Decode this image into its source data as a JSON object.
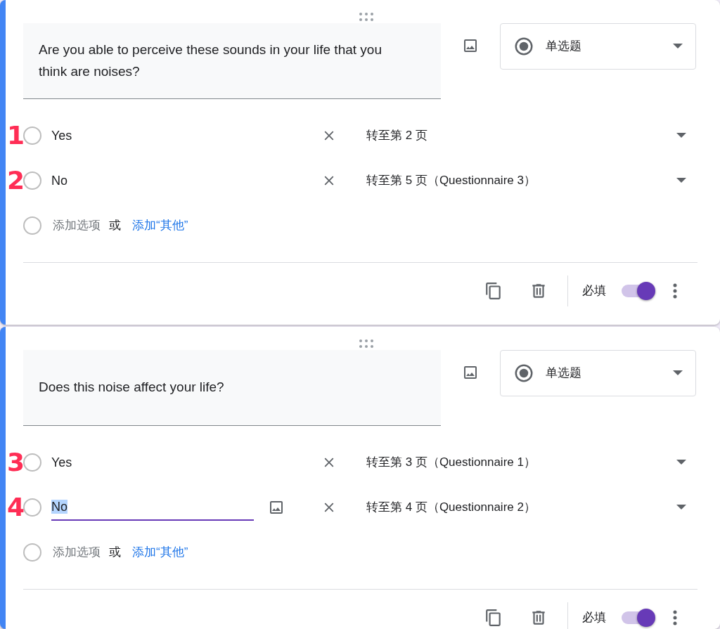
{
  "questions": [
    {
      "title": "Are you able to perceive these sounds in your life that you think are noises?",
      "type_label": "单选题",
      "options": [
        {
          "marker": "1",
          "label": "Yes",
          "checked": false,
          "editing": false,
          "goto": "转至第 2 页"
        },
        {
          "marker": "2",
          "label": "No",
          "checked": false,
          "editing": false,
          "goto": "转至第 5 页（Questionnaire 3）"
        }
      ],
      "add_option_checked": false,
      "add_option": "添加选项",
      "or": "或",
      "add_other": "添加“其他”",
      "required_label": "必填",
      "required": true
    },
    {
      "title": "Does this noise affect your life?",
      "type_label": "单选题",
      "options": [
        {
          "marker": "3",
          "label": "Yes",
          "checked": false,
          "editing": false,
          "goto": "转至第 3 页（Questionnaire 1）"
        },
        {
          "marker": "4",
          "label": "No",
          "checked": false,
          "editing": true,
          "goto": "转至第 4 页（Questionnaire 2）"
        }
      ],
      "add_option_checked": false,
      "add_option": "添加选项",
      "or": "或",
      "add_other": "添加“其他”",
      "required_label": "必填",
      "required": true
    }
  ]
}
